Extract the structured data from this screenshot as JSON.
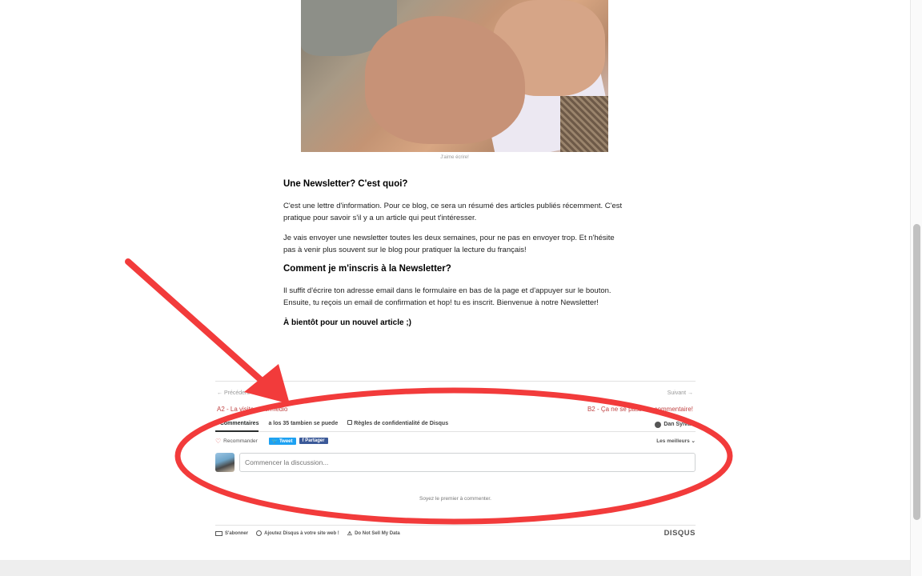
{
  "photo": {
    "caption": "J'aime écrire!"
  },
  "article": {
    "heading1": "Une Newsletter? C'est quoi?",
    "p1": "C'est une lettre d'information. Pour ce blog, ce sera un résumé des articles publiés récemment. C'est pratique pour savoir s'il y a un article qui peut t'intéresser.",
    "p2": "Je vais envoyer une newsletter toutes les deux semaines, pour ne pas en envoyer trop. Et n'hésite pas à venir plus souvent sur le blog pour pratiquer la lecture du français!",
    "heading2": "Comment je m'inscris à la Newsletter?",
    "p3": "Il suffit d'écrire ton adresse email dans le formulaire en bas de la page et d'appuyer sur le bouton. Ensuite, tu reçois un email de confirmation et hop! tu es inscrit. Bienvenue à notre Newsletter!",
    "signoff": "À bientôt pour un nouvel article ;)"
  },
  "post_nav": {
    "prev_small": "← Précédent",
    "prev_link": "A2 - La visite ... termedio",
    "next_small": "Suivant →",
    "next_link": "B2 - Ça ne se passe ... commentaire!"
  },
  "disqus": {
    "tabs": [
      "0 Commentaires",
      "a los 35 tambien se puede",
      "Règles de confidentialité de Disqus"
    ],
    "user": "Dan Sylvain",
    "recommend": "Recommander",
    "tweet": "Tweet",
    "share": "Partager",
    "sort": "Les meilleurs ⌄",
    "input_placeholder": "Commencer la discussion...",
    "empty_message": "Soyez le premier à commenter.",
    "footer": {
      "subscribe": "S'abonner",
      "add_disqus": "Ajoutez Disqus à votre site web !",
      "do_not_sell": "Do Not Sell My Data",
      "logo": "DISQUS"
    }
  },
  "annotation": {
    "color": "#f23b3b"
  }
}
